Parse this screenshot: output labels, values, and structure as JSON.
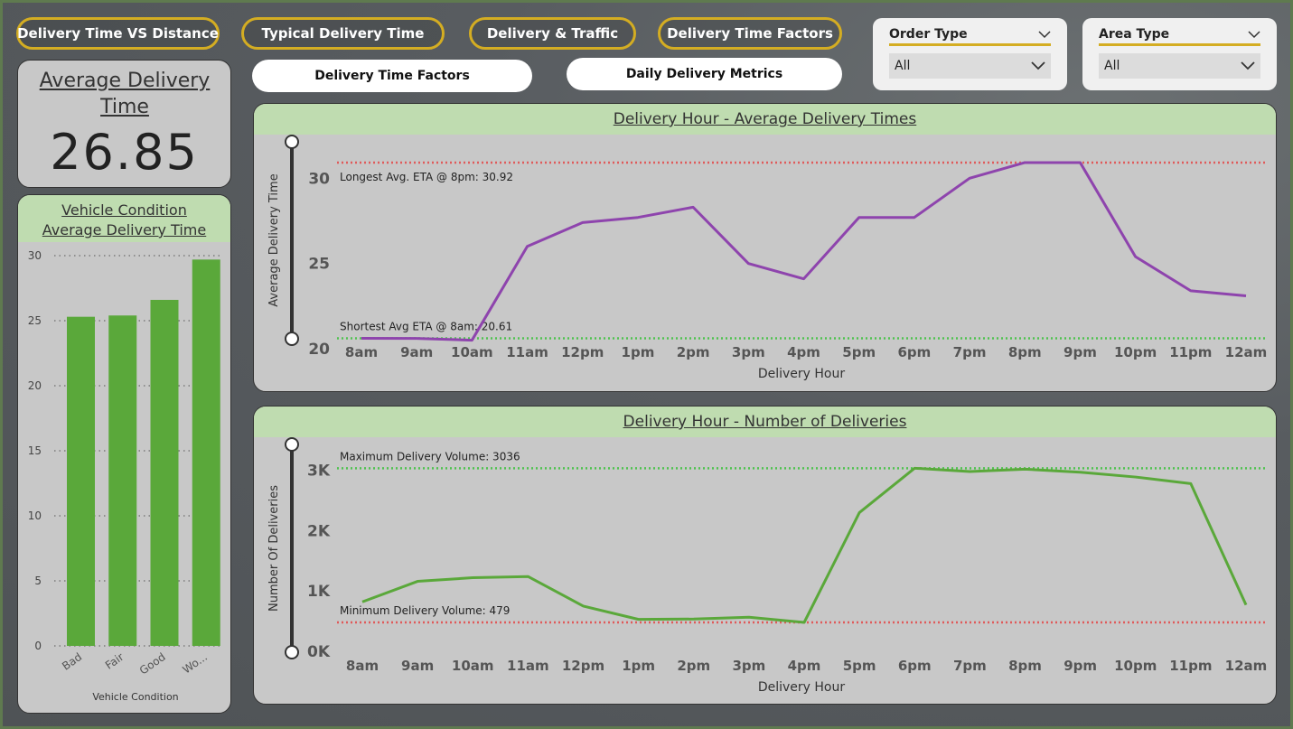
{
  "nav": {
    "btn1": "Delivery Time VS Distance",
    "btn2": "Typical Delivery Time",
    "btn3": "Delivery & Traffic",
    "btn4": "Delivery Time Factors",
    "sub1": "Delivery Time Factors",
    "sub2": "Daily Delivery Metrics"
  },
  "filters": {
    "order_type": {
      "label": "Order Type",
      "value": "All"
    },
    "area_type": {
      "label": "Area Type",
      "value": "All"
    }
  },
  "kpi": {
    "title": "Average Delivery Time",
    "value": "26.85"
  },
  "vehicle": {
    "title_line1": "Vehicle Condition",
    "title_line2": "Average Delivery Time",
    "xlabel": "Vehicle Condition"
  },
  "panels": {
    "times_title": "Delivery Hour - Average Delivery Times",
    "count_title": "Delivery Hour - Number of Deliveries"
  },
  "colors": {
    "purple_line": "#8e44ad",
    "green_line": "#5aa83a",
    "bar": "#5aa83a",
    "max_ref": "#e05a5a",
    "min_ref": "#4fc24f"
  },
  "chart_data": [
    {
      "type": "bar",
      "categories": [
        "Bad",
        "Fair",
        "Good",
        "Wo..."
      ],
      "values": [
        25.3,
        25.4,
        26.6,
        29.7
      ],
      "ylim": [
        0,
        30
      ],
      "yticks": [
        "0",
        "5",
        "10",
        "15",
        "20",
        "25",
        "30"
      ],
      "xlabel": "Vehicle Condition"
    },
    {
      "type": "line",
      "title": "Delivery Hour - Average Delivery Times",
      "xlabel": "Delivery Hour",
      "ylabel": "Average Delivery Time",
      "categories": [
        "8am",
        "9am",
        "10am",
        "11am",
        "12pm",
        "1pm",
        "2pm",
        "3pm",
        "4pm",
        "5pm",
        "6pm",
        "7pm",
        "8pm",
        "9pm",
        "10pm",
        "11pm",
        "12am"
      ],
      "values": [
        20.61,
        20.6,
        20.5,
        26.0,
        27.4,
        27.7,
        28.3,
        25.0,
        24.1,
        27.7,
        27.7,
        30.0,
        30.92,
        30.92,
        25.4,
        23.4,
        23.1
      ],
      "ylim": [
        20,
        31.5
      ],
      "yticks": [
        "20",
        "25",
        "30"
      ],
      "ref_lines": [
        {
          "value": 30.92,
          "label": "Longest Avg. ETA @ 8pm: 30.92",
          "color": "#e05a5a"
        },
        {
          "value": 20.61,
          "label": "Shortest Avg ETA @ 8am: 20.61",
          "color": "#4fc24f"
        }
      ]
    },
    {
      "type": "line",
      "title": "Delivery Hour - Number of Deliveries",
      "xlabel": "Delivery Hour",
      "ylabel": "Number Of Deliveries",
      "categories": [
        "8am",
        "9am",
        "10am",
        "11am",
        "12pm",
        "1pm",
        "2pm",
        "3pm",
        "4pm",
        "5pm",
        "6pm",
        "7pm",
        "8pm",
        "9pm",
        "10pm",
        "11pm",
        "12am"
      ],
      "values": [
        820,
        1160,
        1220,
        1240,
        750,
        530,
        535,
        565,
        479,
        2300,
        3036,
        2980,
        3020,
        2970,
        2890,
        2780,
        770
      ],
      "ylim": [
        0,
        3550
      ],
      "yticks": [
        "0K",
        "1K",
        "2K",
        "3K"
      ],
      "ref_lines": [
        {
          "value": 3036,
          "label": "Maximum Delivery Volume: 3036",
          "color": "#4fc24f"
        },
        {
          "value": 479,
          "label": "Minimum Delivery Volume: 479",
          "color": "#e05a5a"
        }
      ]
    }
  ]
}
